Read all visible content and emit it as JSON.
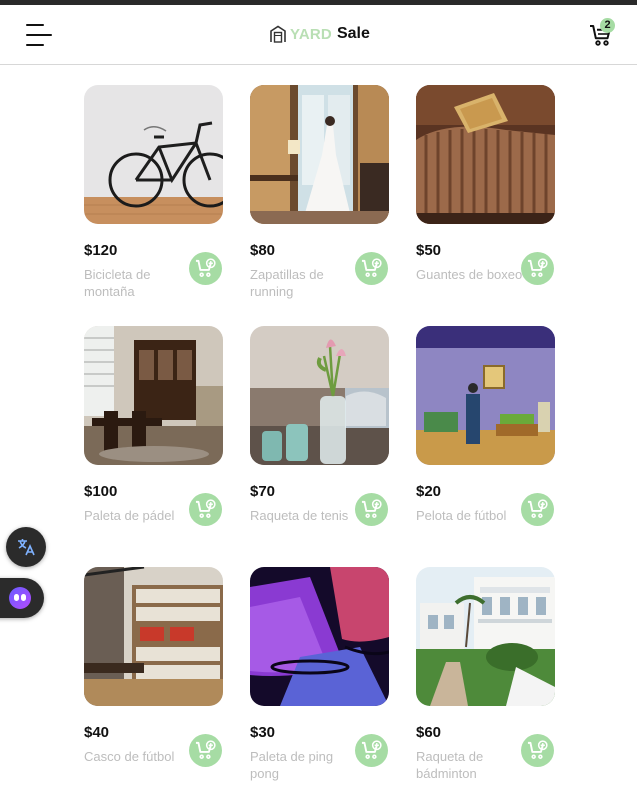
{
  "header": {
    "logo_yard": "YARD",
    "logo_sale": "Sale",
    "cart_count": "2"
  },
  "products": [
    {
      "price": "$120",
      "name": "Bicicleta de montaña",
      "image": "bicycle-photo"
    },
    {
      "price": "$80",
      "name": "Zapatillas de running",
      "image": "wedding-dress-photo"
    },
    {
      "price": "$50",
      "name": "Guantes de boxeo",
      "image": "striped-sofa-photo"
    },
    {
      "price": "$100",
      "name": "Paleta de pádel",
      "image": "dining-room-photo"
    },
    {
      "price": "$70",
      "name": "Raqueta de tenis",
      "image": "tulip-vase-photo"
    },
    {
      "price": "$20",
      "name": "Pelota de fútbol",
      "image": "purple-living-room-photo"
    },
    {
      "price": "$40",
      "name": "Casco de fútbol",
      "image": "bookshelf-office-photo"
    },
    {
      "price": "$30",
      "name": "Paleta de ping pong",
      "image": "purple-lampshades-photo"
    },
    {
      "price": "$60",
      "name": "Raqueta de bádminton",
      "image": "white-house-photo"
    }
  ],
  "colors": {
    "accent_green": "#a6dca4",
    "logo_green": "#b9dfb4",
    "muted_text": "#bdbdbd"
  }
}
